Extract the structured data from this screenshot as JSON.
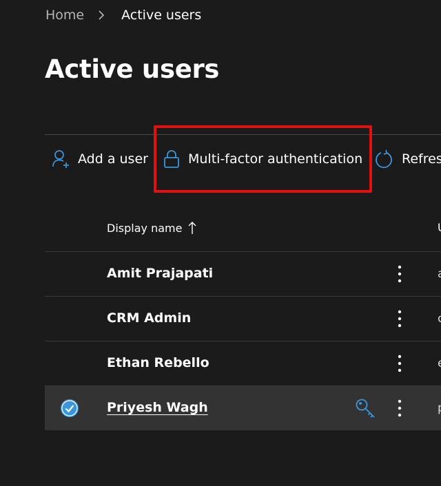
{
  "breadcrumb": {
    "home": "Home",
    "current": "Active users"
  },
  "page_title": "Active users",
  "toolbar": {
    "add_user": "Add a user",
    "mfa": "Multi-factor authentication",
    "refresh": "Refres"
  },
  "table": {
    "columns": [
      "Display name",
      "U"
    ],
    "sort_direction": "ascending",
    "rows": [
      {
        "display_name": "Amit Prajapati",
        "next_col": "a",
        "selected": false
      },
      {
        "display_name": "CRM Admin",
        "next_col": "c",
        "selected": false
      },
      {
        "display_name": "Ethan Rebello",
        "next_col": "e",
        "selected": false
      },
      {
        "display_name": "Priyesh Wagh",
        "next_col": "p",
        "selected": true
      }
    ]
  },
  "icons": {
    "breadcrumb_separator": "chevron-right-icon",
    "add_user": "add-person-icon",
    "mfa": "lock-icon",
    "refresh": "refresh-icon",
    "sort": "sort-up-arrow-icon",
    "row_menu": "more-vertical-icon",
    "selected": "checkmark-circle-icon",
    "key": "key-icon"
  },
  "colors": {
    "background": "#1b1b1b",
    "accent": "#3a96dd",
    "highlight": "#e11111",
    "selected_row": "#333333"
  }
}
